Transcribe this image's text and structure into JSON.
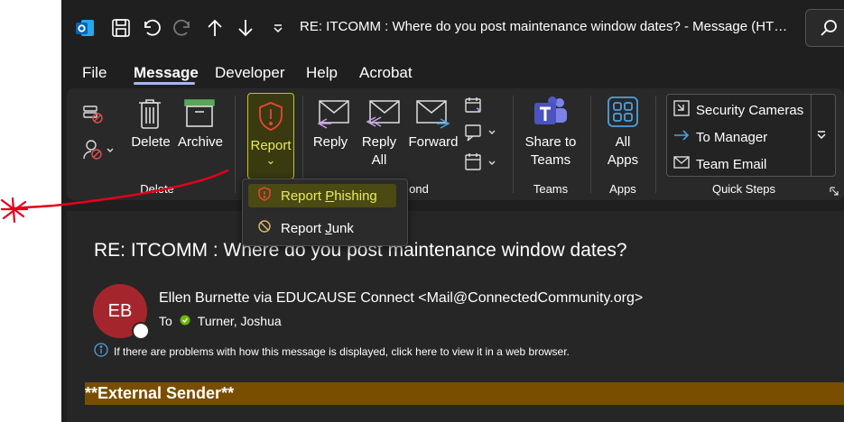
{
  "window": {
    "title": "RE: ITCOMM : Where do you post maintenance window dates?  -  Message (HT…"
  },
  "menu": [
    "File",
    "Message",
    "Developer",
    "Help",
    "Acrobat"
  ],
  "ribbon": {
    "delete_group": {
      "delete_label": "Delete",
      "archive_label": "Archive",
      "group_label": "Delete"
    },
    "report": {
      "label": "Report",
      "caret": "⌄"
    },
    "respond_group": {
      "reply": "Reply",
      "reply_all_1": "Reply",
      "reply_all_2": "All",
      "forward": "Forward",
      "group_label": "ond"
    },
    "teams_group": {
      "share_1": "Share to",
      "share_2": "Teams",
      "group_label": "Teams"
    },
    "apps_group": {
      "all_1": "All",
      "all_2": "Apps",
      "group_label": "Apps"
    },
    "quick_steps": {
      "items": [
        "Security Cameras",
        "To Manager",
        "Team Email"
      ],
      "group_label": "Quick Steps"
    }
  },
  "report_menu": {
    "phishing_pre": "Report ",
    "phishing_key": "P",
    "phishing_post": "hishing",
    "junk_pre": "Report ",
    "junk_key": "J",
    "junk_post": "unk"
  },
  "message": {
    "subject": "RE: ITCOMM : Where do you post maintenance window dates?",
    "avatar_initials": "EB",
    "sender": "Ellen Burnette via EDUCAUSE Connect <Mail@ConnectedCommunity.org>",
    "to_label": "To",
    "to_name": "Turner, Joshua",
    "info": "If there are problems with how this message is displayed, click here to view it in a web browser.",
    "external_banner": "**External Sender**"
  },
  "colors": {
    "accent": "#a3b9ef",
    "report_highlight": "#c7c900",
    "avatar": "#a4262c",
    "external_banner": "#7a4e00",
    "annotation": "#e3001b"
  }
}
